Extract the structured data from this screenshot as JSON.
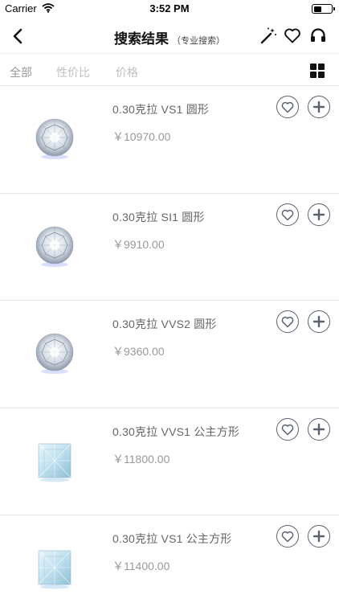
{
  "status": {
    "carrier": "Carrier",
    "time": "3:52 PM"
  },
  "nav": {
    "title": "搜索结果",
    "subtitle": "（专业搜索）",
    "icons": [
      "back-icon",
      "magic-wand-icon",
      "heart-icon",
      "headset-icon"
    ]
  },
  "filters": {
    "tabs": [
      {
        "label": "全部",
        "active": true
      },
      {
        "label": "性价比",
        "active": false
      },
      {
        "label": "价格",
        "active": false
      }
    ],
    "view_icon": "grid-view-icon"
  },
  "colors": {
    "icon_stroke": "#5a6170",
    "divider": "#e6e6e6",
    "text_muted": "#999999",
    "tab_inactive": "#c0c0c0"
  },
  "items": [
    {
      "name": "0.30克拉 VS1 圆形",
      "price": "￥10970.00",
      "shape": "round"
    },
    {
      "name": "0.30克拉 SI1 圆形",
      "price": "￥9910.00",
      "shape": "round"
    },
    {
      "name": "0.30克拉 VVS2 圆形",
      "price": "￥9360.00",
      "shape": "round"
    },
    {
      "name": "0.30克拉 VVS1 公主方形",
      "price": "￥11800.00",
      "shape": "princess"
    },
    {
      "name": "0.30克拉 VS1 公主方形",
      "price": "￥11400.00",
      "shape": "princess"
    }
  ]
}
